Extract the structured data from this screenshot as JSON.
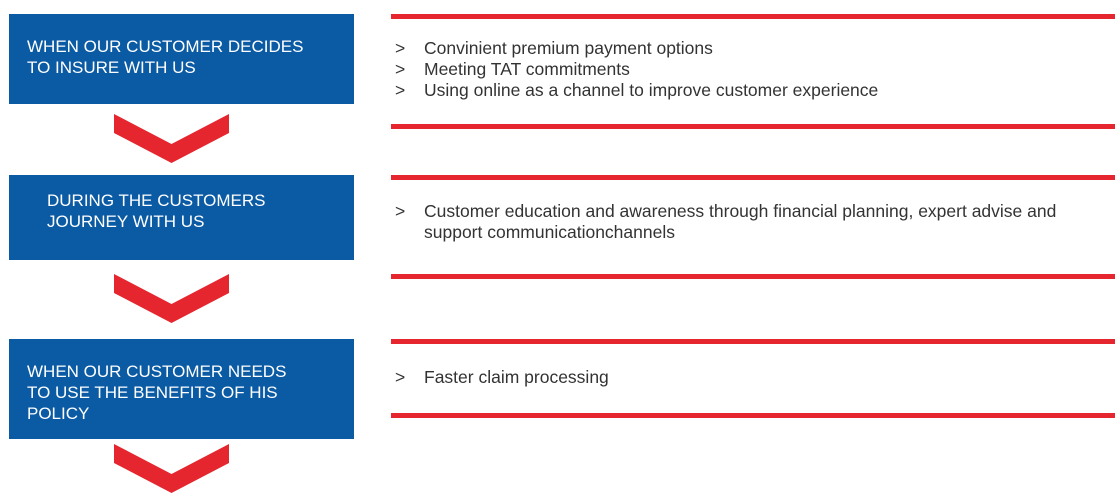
{
  "colors": {
    "stage_fill": "#0a5aa4",
    "accent_red": "#e5262e",
    "text": "#333333"
  },
  "bullet_marker": ">",
  "stages": [
    {
      "title": "WHEN OUR CUSTOMER DECIDES\nTO INSURE WITH US",
      "items": [
        "Convinient premium payment  options",
        "Meeting TAT commitments",
        "Using online as a channel to  improve customer experience"
      ]
    },
    {
      "title": "DURING  THE CUSTOMERS\nJOURNEY WITH US",
      "items": [
        "Customer education and awareness through financial planning, expert advise and support communicationchannels"
      ]
    },
    {
      "title": "WHEN OUR CUSTOMER NEEDS\nTO USE THE BENEFITS OF HIS\nPOLICY",
      "items": [
        "Faster claim processing"
      ]
    }
  ]
}
